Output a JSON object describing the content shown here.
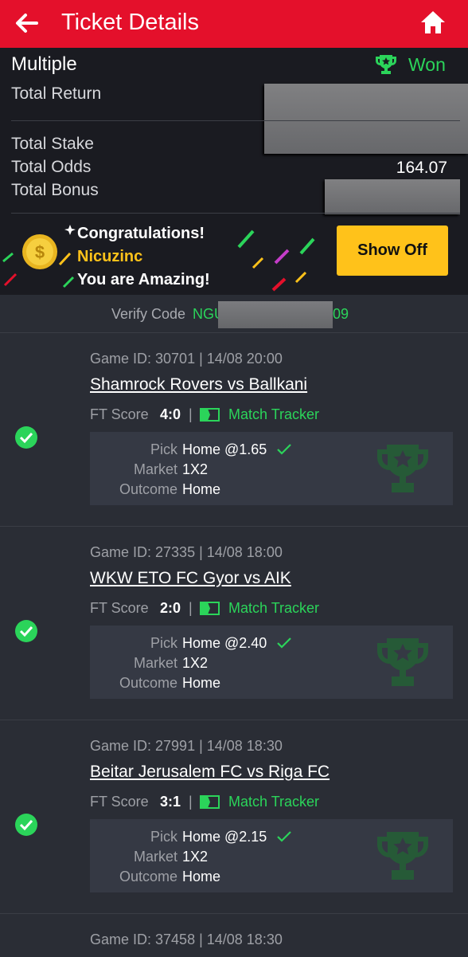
{
  "header": {
    "title": "Ticket Details",
    "back_icon": "arrow-left-icon",
    "home_icon": "home-icon"
  },
  "summary": {
    "type_label": "Multiple",
    "status": "Won",
    "total_return_label": "Total Return",
    "total_stake_label": "Total Stake",
    "total_odds_label": "Total Odds",
    "total_odds_value": "164.07",
    "total_bonus_label": "Total Bonus"
  },
  "banner": {
    "line1": "Congratulations!",
    "username": "Nicuzinc",
    "line3": "You are Amazing!",
    "button": "Show Off"
  },
  "verify": {
    "label": "Verify Code",
    "code_start": "NGU",
    "code_end": "09"
  },
  "games": [
    {
      "id_line": "Game ID: 30701 | 14/08 20:00",
      "teams": "Shamrock Rovers vs Ballkani",
      "ft_label": "FT Score",
      "score": "4:0",
      "sep": "|",
      "tracker": "Match Tracker",
      "pick_label": "Pick",
      "pick": "Home @1.65",
      "market_label": "Market",
      "market": "1X2",
      "outcome_label": "Outcome",
      "outcome": "Home"
    },
    {
      "id_line": "Game ID: 27335 | 14/08 18:00",
      "teams": "WKW ETO FC Gyor vs AIK",
      "ft_label": "FT Score",
      "score": "2:0",
      "sep": "|",
      "tracker": "Match Tracker",
      "pick_label": "Pick",
      "pick": "Home @2.40",
      "market_label": "Market",
      "market": "1X2",
      "outcome_label": "Outcome",
      "outcome": "Home"
    },
    {
      "id_line": "Game ID: 27991 | 14/08 18:30",
      "teams": "Beitar Jerusalem FC vs Riga FC",
      "ft_label": "FT Score",
      "score": "3:1",
      "sep": "|",
      "tracker": "Match Tracker",
      "pick_label": "Pick",
      "pick": "Home @2.15",
      "market_label": "Market",
      "market": "1X2",
      "outcome_label": "Outcome",
      "outcome": "Home"
    },
    {
      "id_line": "Game ID: 37458 | 14/08 18:30"
    }
  ],
  "colors": {
    "brand_red": "#e4102b",
    "win_green": "#2bd45a",
    "button_yellow": "#ffc21a"
  }
}
